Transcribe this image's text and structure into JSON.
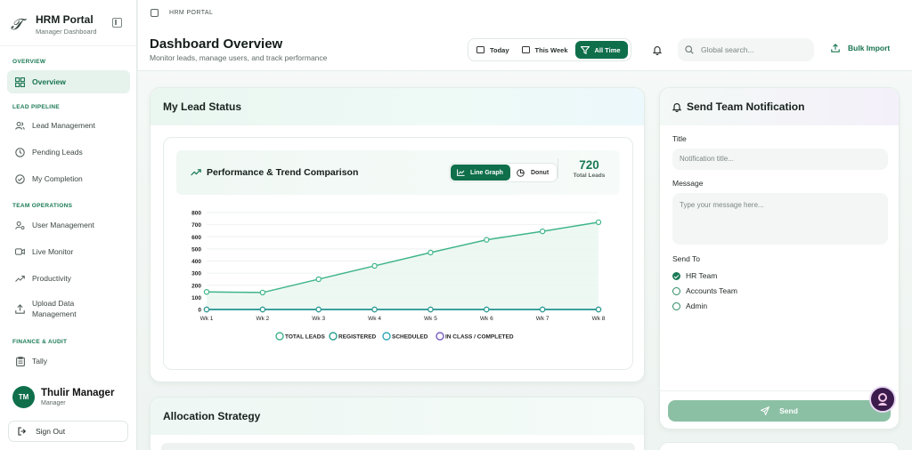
{
  "sidebar": {
    "brand_title": "HRM Portal",
    "brand_subtitle": "Manager Dashboard",
    "sections": {
      "overview": "OVERVIEW",
      "lead_pipeline": "LEAD PIPELINE",
      "team_operations": "TEAM OPERATIONS",
      "finance_audit": "FINANCE & AUDIT"
    },
    "items": {
      "overview": "Overview",
      "lead_management": "Lead Management",
      "pending_leads": "Pending Leads",
      "my_completion": "My Completion",
      "user_management": "User Management",
      "live_monitor": "Live Monitor",
      "productivity": "Productivity",
      "upload_data": "Upload Data Management",
      "tally": "Tally"
    },
    "user": {
      "initials": "TM",
      "name": "Thulir Manager",
      "role": "Manager"
    },
    "sign_out": "Sign Out"
  },
  "header": {
    "breadcrumb": "HRM PORTAL",
    "title": "Dashboard Overview",
    "subtitle": "Monitor leads, manage users, and track performance",
    "ranges": {
      "today": "Today",
      "this_week": "This Week",
      "all_time": "All Time"
    },
    "search_placeholder": "Global search...",
    "bulk_import": "Bulk Import"
  },
  "lead_status": {
    "title": "My Lead Status",
    "chart_title": "Performance & Trend Comparison",
    "toggle": {
      "line": "Line Graph",
      "donut": "Donut"
    },
    "total_value": "720",
    "total_label": "Total Leads"
  },
  "chart_data": {
    "type": "line",
    "x": [
      "Wk 1",
      "Wk 2",
      "Wk 3",
      "Wk 4",
      "Wk 5",
      "Wk 6",
      "Wk 7",
      "Wk 8"
    ],
    "ylim": [
      0,
      800
    ],
    "yticks": [
      0,
      100,
      200,
      300,
      400,
      500,
      600,
      700,
      800
    ],
    "series": [
      {
        "name": "TOTAL LEADS",
        "values": [
          145,
          140,
          250,
          360,
          470,
          575,
          645,
          720
        ],
        "color": "#3fb58a"
      },
      {
        "name": "REGISTERED",
        "values": [
          0,
          0,
          0,
          0,
          0,
          0,
          0,
          0
        ],
        "color": "#2a9d8f"
      },
      {
        "name": "SCHEDULED",
        "values": [
          0,
          0,
          0,
          0,
          0,
          0,
          0,
          0
        ],
        "color": "#31a7b5"
      },
      {
        "name": "IN CLASS / COMPLETED",
        "values": [
          0,
          0,
          0,
          0,
          0,
          0,
          0,
          0
        ],
        "color": "#7a5bc4"
      }
    ]
  },
  "notification": {
    "title": "Send Team Notification",
    "title_label": "Title",
    "title_placeholder": "Notification title...",
    "message_label": "Message",
    "message_placeholder": "Type your message here...",
    "send_to_label": "Send To",
    "recipients": [
      "HR Team",
      "Accounts Team",
      "Admin"
    ],
    "selected": "HR Team",
    "send_button": "Send"
  },
  "allocation": {
    "title": "Allocation Strategy"
  },
  "colors": {
    "brand": "#0f6f4b",
    "accent": "#3fb58a"
  }
}
